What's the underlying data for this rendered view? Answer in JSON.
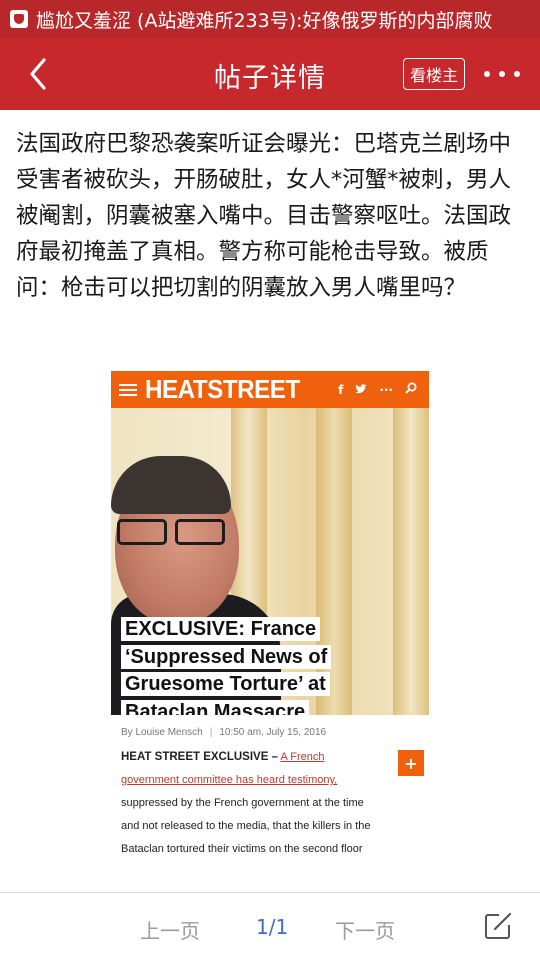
{
  "status_bar": {
    "ticker_text": "尴尬又羞涩 (A站避难所233号):好像俄罗斯的内部腐败"
  },
  "nav": {
    "title": "帖子详情",
    "op_only_label": "看楼主"
  },
  "post": {
    "text": "法国政府巴黎恐袭案听证会曝光：巴塔克兰剧场中受害者被砍头，开肠破肚，女人*河蟹*被刺，男人被阉割，阴囊被塞入嘴中。目击警察呕吐。法国政府最初掩盖了真相。警方称可能枪击导致。被质问：枪击可以把切割的阴囊放入男人嘴里吗？"
  },
  "article_image": {
    "logo": "HEATSTREET",
    "social": {
      "facebook": "f",
      "twitter": "🐦",
      "more": "···",
      "search": "⌕"
    },
    "headline_lines": [
      "EXCLUSIVE: France",
      "‘Suppressed News of",
      "Gruesome Torture’ at",
      "Bataclan Massacre"
    ],
    "byline_author": "By Louise Mensch",
    "byline_time": "10:50 am, July 15, 2016",
    "lead": "HEAT STREET EXCLUSIVE –",
    "link_text": "A French government committee has heard testimony,",
    "body_rest": "suppressed by the French government at the time and not released to the media, that the killers in the Bataclan tortured their victims on the second floor",
    "plus_label": "+",
    "colors": {
      "brand": "#f0610e"
    }
  },
  "pagination": {
    "prev_label": "上一页",
    "page_indicator": "1/1",
    "next_label": "下一页"
  },
  "colors": {
    "header_red": "#c6282c",
    "status_red": "#b8282b",
    "page_blue": "#3a6ec7"
  },
  "icons": {
    "back": "chevron-left-icon",
    "more": "more-dots-icon",
    "edit": "edit-icon",
    "app": "app-notification-icon"
  }
}
